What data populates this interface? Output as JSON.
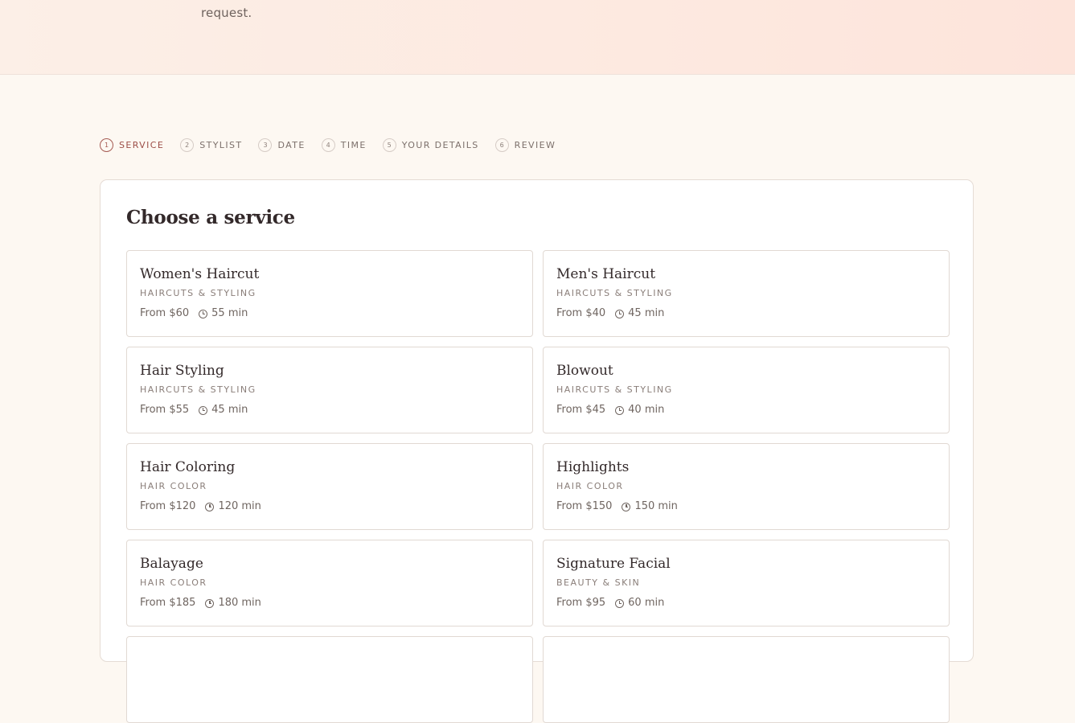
{
  "hero": {
    "text": "request."
  },
  "steps": [
    {
      "num": "1",
      "label": "SERVICE",
      "active": true
    },
    {
      "num": "2",
      "label": "STYLIST",
      "active": false
    },
    {
      "num": "3",
      "label": "DATE",
      "active": false
    },
    {
      "num": "4",
      "label": "TIME",
      "active": false
    },
    {
      "num": "5",
      "label": "YOUR DETAILS",
      "active": false
    },
    {
      "num": "6",
      "label": "REVIEW",
      "active": false
    }
  ],
  "card": {
    "title": "Choose a service"
  },
  "services": [
    {
      "name": "Women's Haircut",
      "category": "HAIRCUTS & STYLING",
      "price": "From $60",
      "duration": "55 min"
    },
    {
      "name": "Men's Haircut",
      "category": "HAIRCUTS & STYLING",
      "price": "From $40",
      "duration": "45 min"
    },
    {
      "name": "Hair Styling",
      "category": "HAIRCUTS & STYLING",
      "price": "From $55",
      "duration": "45 min"
    },
    {
      "name": "Blowout",
      "category": "HAIRCUTS & STYLING",
      "price": "From $45",
      "duration": "40 min"
    },
    {
      "name": "Hair Coloring",
      "category": "HAIR COLOR",
      "price": "From $120",
      "duration": "120 min"
    },
    {
      "name": "Highlights",
      "category": "HAIR COLOR",
      "price": "From $150",
      "duration": "150 min"
    },
    {
      "name": "Balayage",
      "category": "HAIR COLOR",
      "price": "From $185",
      "duration": "180 min"
    },
    {
      "name": "Signature Facial",
      "category": "BEAUTY & SKIN",
      "price": "From $95",
      "duration": "60 min"
    },
    {
      "name": "",
      "category": "",
      "price": "",
      "duration": ""
    },
    {
      "name": "",
      "category": "",
      "price": "",
      "duration": ""
    }
  ],
  "icons": {
    "duration": "clock-icon"
  },
  "colors": {
    "accent": "#9c4e47",
    "background": "#fdf8f2",
    "hero_bg": "#fde9e0"
  }
}
